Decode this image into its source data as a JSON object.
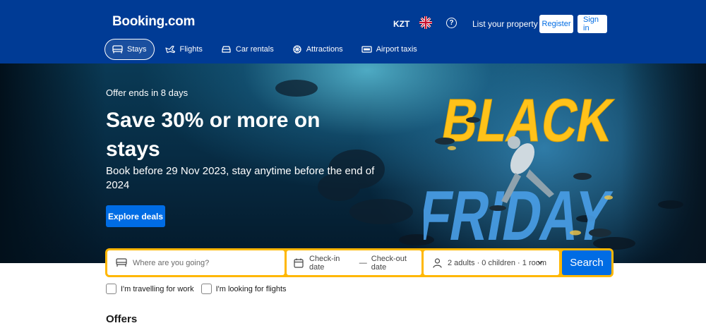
{
  "header": {
    "logo": "Booking.com",
    "currency": "KZT",
    "help_icon": "?",
    "list_property": "List your property",
    "register": "Register",
    "sign_in": "Sign in",
    "bg_color": "#003b95"
  },
  "nav": [
    {
      "label": "Stays",
      "icon": "bed-icon",
      "active": true
    },
    {
      "label": "Flights",
      "icon": "plane-icon",
      "active": false
    },
    {
      "label": "Car rentals",
      "icon": "car-icon",
      "active": false
    },
    {
      "label": "Attractions",
      "icon": "attractions-icon",
      "active": false
    },
    {
      "label": "Airport taxis",
      "icon": "taxi-icon",
      "active": false
    }
  ],
  "hero": {
    "offer_ends": "Offer ends in 8 days",
    "title": "Save 30% or more on stays",
    "subtitle": "Book before 29 Nov 2023, stay anytime before the end of 2024",
    "cta": "Explore deals",
    "banner_line1": "BLACK",
    "banner_line2": "FRIDAY"
  },
  "search": {
    "destination_placeholder": "Where are you going?",
    "checkin": "Check-in date",
    "date_separator": "—",
    "checkout": "Check-out date",
    "guests": "2 adults · 0 children · 1 room",
    "button": "Search",
    "accent": "#ffb700"
  },
  "checkboxes": [
    {
      "label": "I'm travelling for work"
    },
    {
      "label": "I'm looking for flights"
    }
  ],
  "section": {
    "offers_heading": "Offers"
  },
  "colors": {
    "primary_button": "#006ce4",
    "banner_yellow": "#ffc21a",
    "banner_blue": "#4a9fe8"
  }
}
